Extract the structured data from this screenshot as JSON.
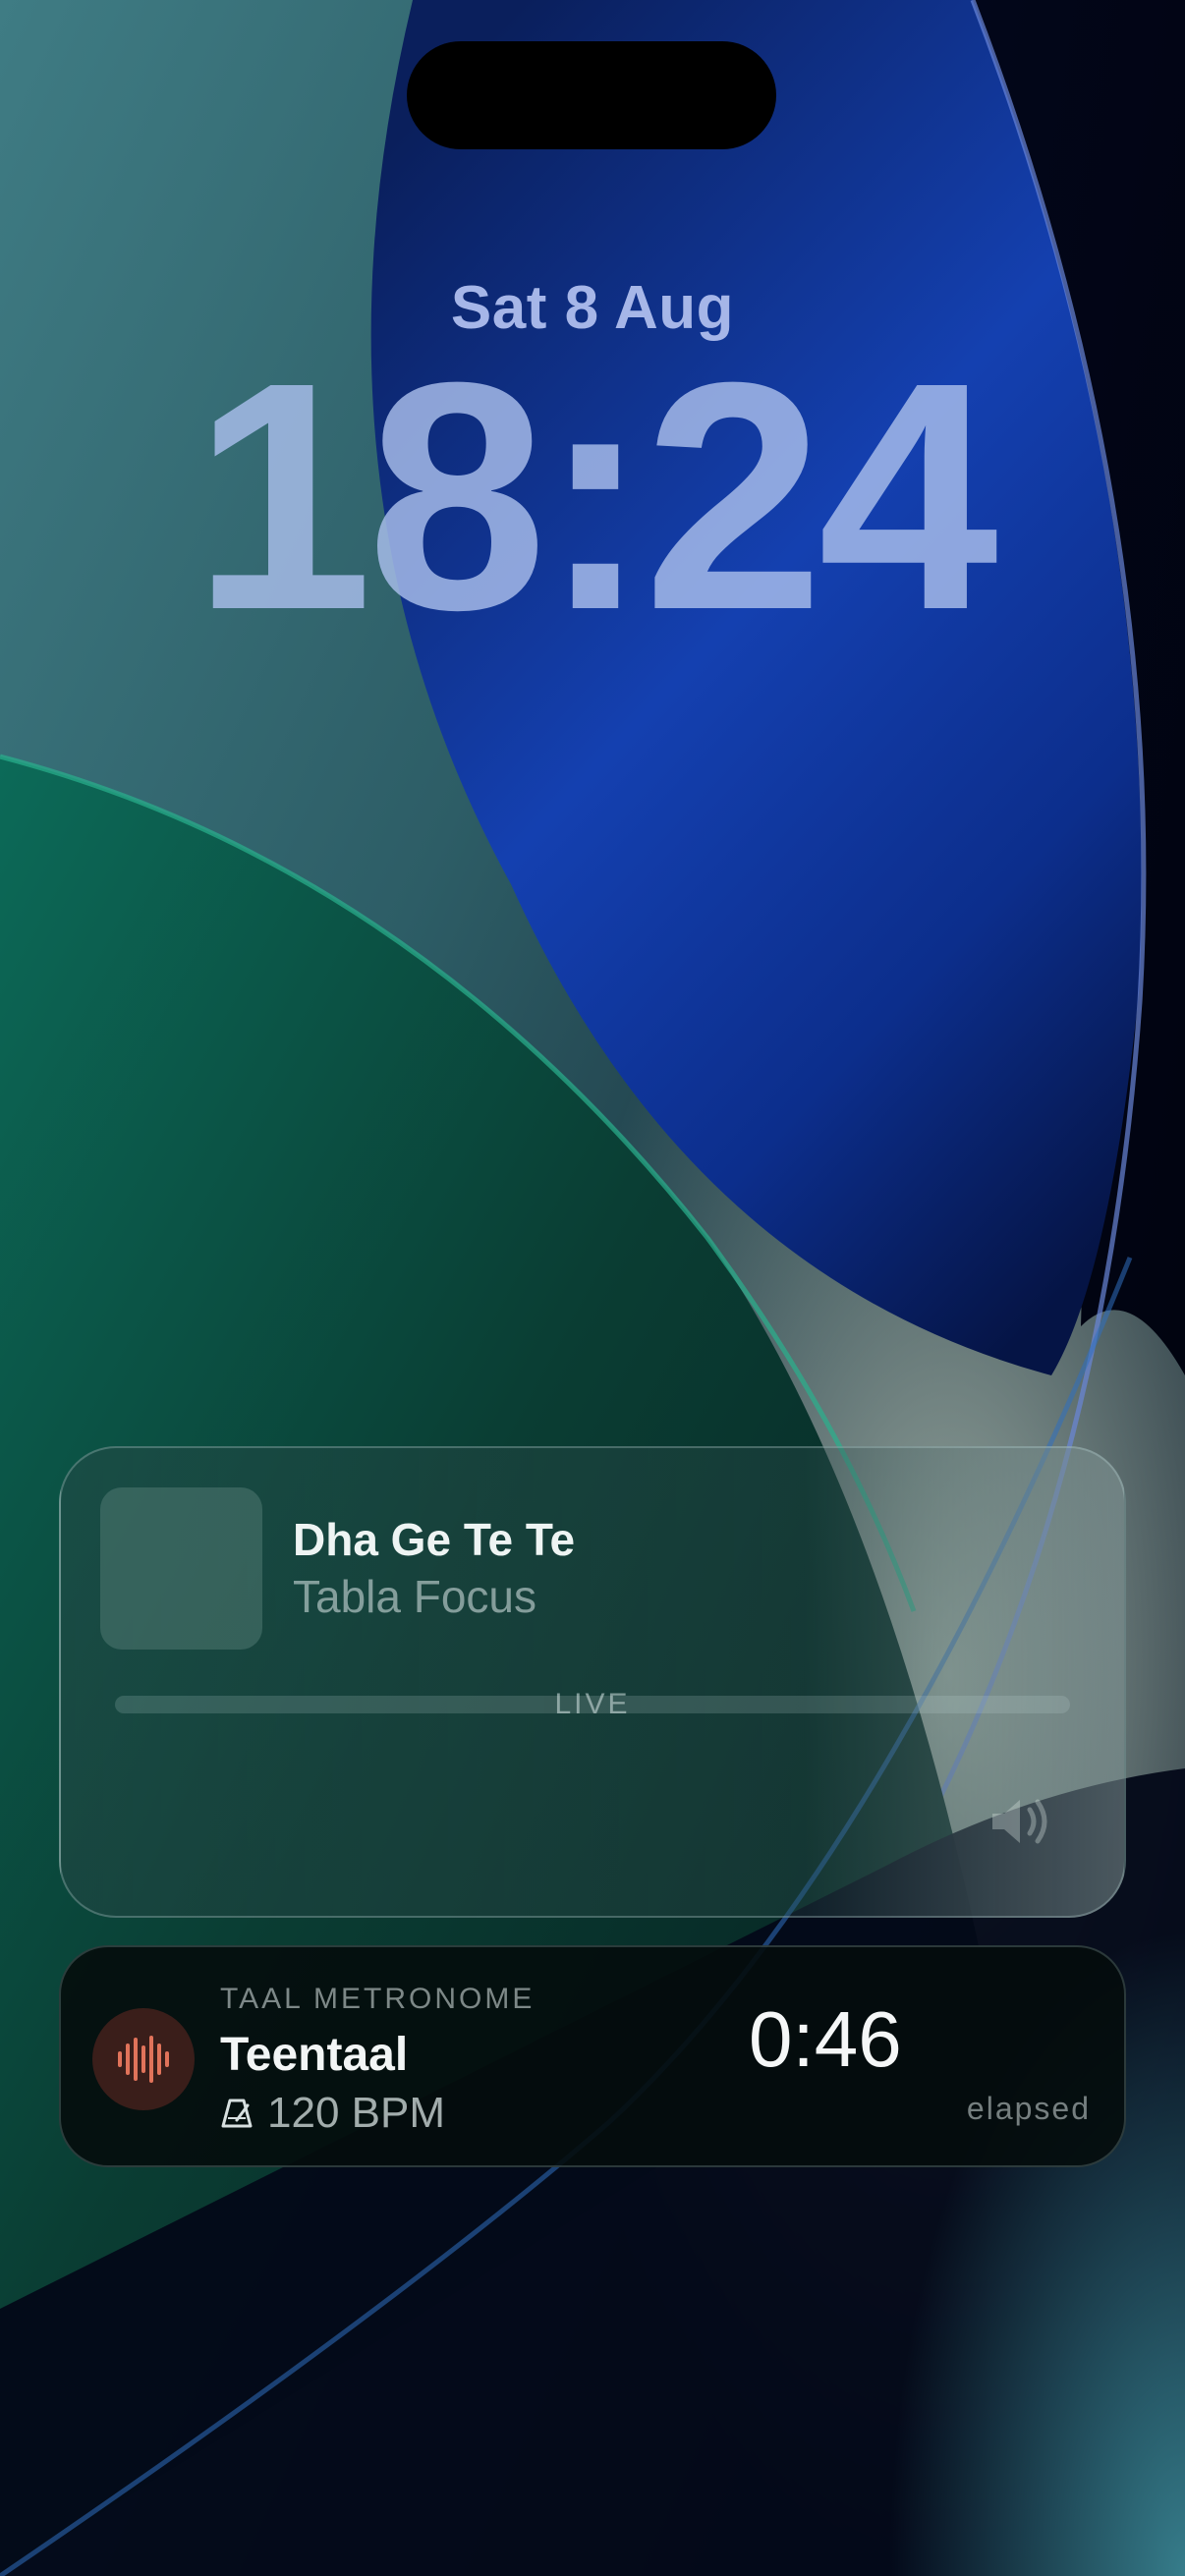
{
  "lockscreen": {
    "date": "Sat 8 Aug",
    "time": "18:24"
  },
  "now_playing": {
    "title": "Dha Ge Te Te",
    "subtitle": "Tabla Focus",
    "status": "LIVE",
    "artwork_icon": "album-art",
    "speaker_icon": "speaker-icon"
  },
  "live_activity": {
    "app_name": "TAAL METRONOME",
    "taal_name": "Teentaal",
    "bpm": "120 BPM",
    "timer": "0:46",
    "timer_label": "elapsed",
    "icon": "waveform-icon",
    "bpm_icon": "metronome-icon",
    "accent_color": "#e0735a"
  }
}
